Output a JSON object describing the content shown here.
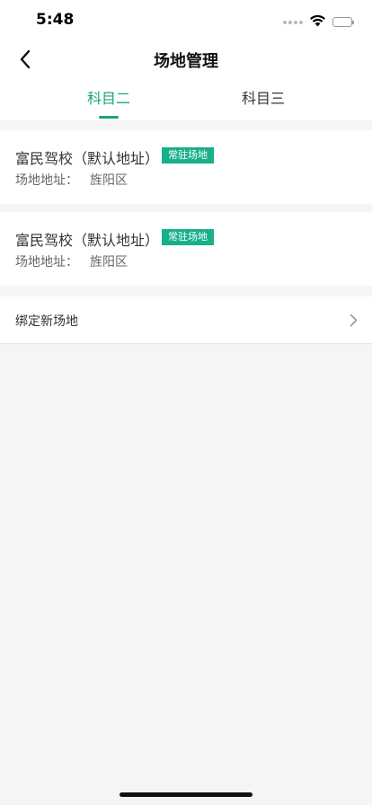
{
  "status_bar": {
    "time": "5:48"
  },
  "nav": {
    "title": "场地管理"
  },
  "tabs": [
    {
      "label": "科目二",
      "active": true
    },
    {
      "label": "科目三",
      "active": false
    }
  ],
  "venues": [
    {
      "name": "富民驾校（默认地址）",
      "badge": "常驻场地",
      "address_label": "场地地址：",
      "address": "旌阳区"
    },
    {
      "name": "富民驾校（默认地址）",
      "badge": "常驻场地",
      "address_label": "场地地址：",
      "address": "旌阳区"
    }
  ],
  "bind_new": {
    "label": "绑定新场地"
  },
  "colors": {
    "accent": "#16a67f",
    "badge": "#17b08b"
  }
}
